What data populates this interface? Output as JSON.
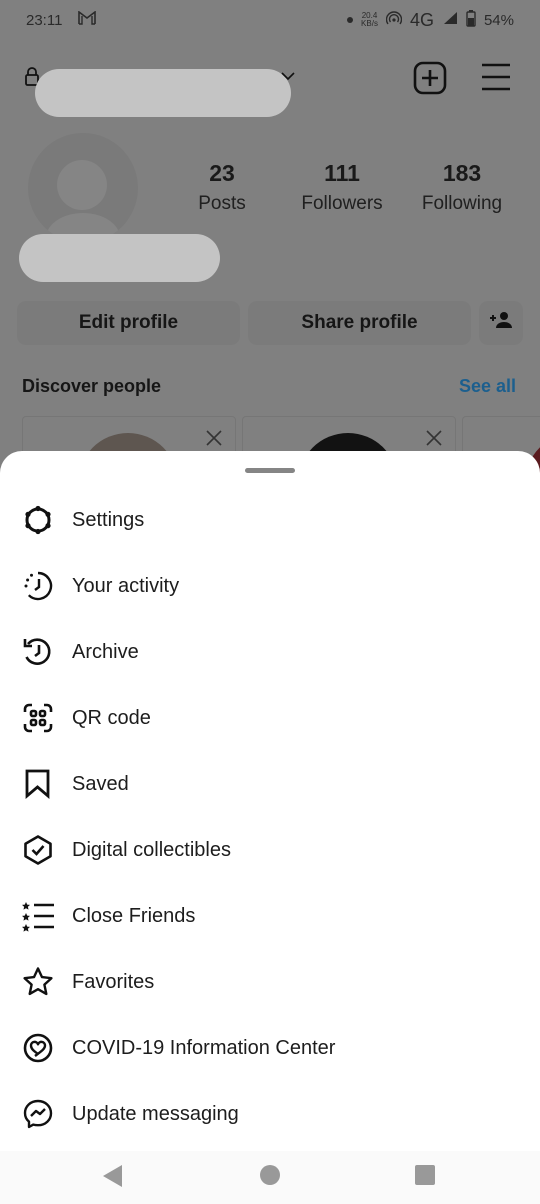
{
  "status_bar": {
    "time": "23:11",
    "notification_icon": "gmail-icon",
    "net_speed_value": "20.4",
    "net_speed_unit": "KB/s",
    "network": "4G",
    "battery": "54%"
  },
  "header": {
    "username": "",
    "new_post_icon": "plus-square-icon",
    "menu_icon": "hamburger-menu-icon"
  },
  "stats": {
    "posts": {
      "value": "23",
      "label": "Posts"
    },
    "followers": {
      "value": "111",
      "label": "Followers"
    },
    "following": {
      "value": "183",
      "label": "Following"
    }
  },
  "actions": {
    "edit_profile": "Edit profile",
    "share_profile": "Share profile"
  },
  "discover": {
    "title": "Discover people",
    "see_all": "See all"
  },
  "sheet": {
    "items": [
      {
        "label": "Settings",
        "icon": "settings-icon"
      },
      {
        "label": "Your activity",
        "icon": "activity-icon"
      },
      {
        "label": "Archive",
        "icon": "archive-icon"
      },
      {
        "label": "QR code",
        "icon": "qr-code-icon"
      },
      {
        "label": "Saved",
        "icon": "bookmark-icon"
      },
      {
        "label": "Digital collectibles",
        "icon": "collectibles-icon"
      },
      {
        "label": "Close Friends",
        "icon": "close-friends-icon"
      },
      {
        "label": "Favorites",
        "icon": "star-icon"
      },
      {
        "label": "COVID-19 Information Center",
        "icon": "covid-info-icon"
      },
      {
        "label": "Update messaging",
        "icon": "messenger-icon"
      }
    ]
  },
  "colors": {
    "accent_link": "#1c5f8e",
    "sheet_bg": "#ffffff",
    "scrim": "#808080"
  }
}
